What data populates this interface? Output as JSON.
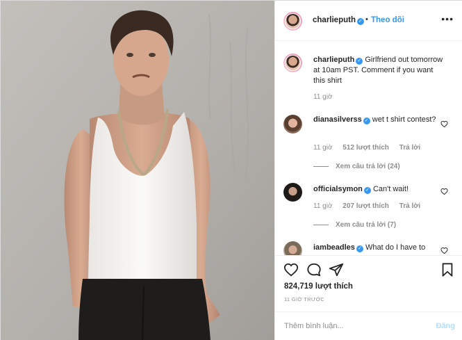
{
  "post": {
    "author": "charlieputh",
    "follow_label": "Theo dõi",
    "dot": "•",
    "more_label": "•••",
    "caption": "Girlfriend out tomorrow at 10am PST. Comment if you want this shirt",
    "caption_time": "11 giờ"
  },
  "comments": [
    {
      "user": "dianasilverss",
      "text": "wet t shirt contest?",
      "time": "11 giờ",
      "likes": "512 lượt thích",
      "reply_label": "Trả lời",
      "view_replies": "Xem câu trả lời (24)"
    },
    {
      "user": "officialsymon",
      "text": "Can't wait!",
      "time": "11 giờ",
      "likes": "207 lượt thích",
      "reply_label": "Trả lời",
      "view_replies": "Xem câu trả lời (7)"
    },
    {
      "user": "iambeadles",
      "text": "What do I have to"
    }
  ],
  "footer": {
    "likes": "824,719 lượt thích",
    "time_ago": "11 GIỜ TRƯỚC",
    "comment_placeholder": "Thêm bình luận...",
    "post_label": "Đăng"
  },
  "icons": {
    "verified": "verified-badge-icon",
    "like": "heart-icon",
    "comment": "comment-bubble-icon",
    "share": "paper-plane-icon",
    "save": "bookmark-icon"
  },
  "colors": {
    "accent": "#3897f0",
    "post_disabled": "#b2dffc",
    "muted": "#8e8e8e"
  }
}
